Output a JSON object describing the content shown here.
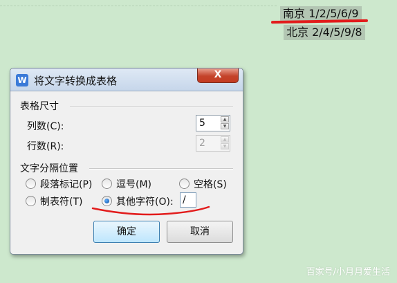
{
  "document": {
    "line1": "南京 1/2/5/6/9",
    "line2": "北京 2/4/5/9/8"
  },
  "dialog": {
    "app_icon": "W",
    "title": "将文字转换成表格",
    "close_label": "X",
    "size_section": {
      "label": "表格尺寸",
      "columns_label": "列数(C):",
      "columns_value": "5",
      "rows_label": "行数(R):",
      "rows_value": "2"
    },
    "separator_section": {
      "label": "文字分隔位置",
      "options": [
        {
          "label": "段落标记(P)",
          "selected": false
        },
        {
          "label": "逗号(M)",
          "selected": false
        },
        {
          "label": "空格(S)",
          "selected": false
        },
        {
          "label": "制表符(T)",
          "selected": false
        },
        {
          "label": "其他字符(O):",
          "selected": true
        }
      ],
      "other_value": "/"
    },
    "ok_label": "确定",
    "cancel_label": "取消"
  },
  "watermark": "百家号/小月月爱生活",
  "colors": {
    "background": "#cde8cd",
    "highlight": "#b3c6b3",
    "annotation_red": "#e21b1b"
  }
}
